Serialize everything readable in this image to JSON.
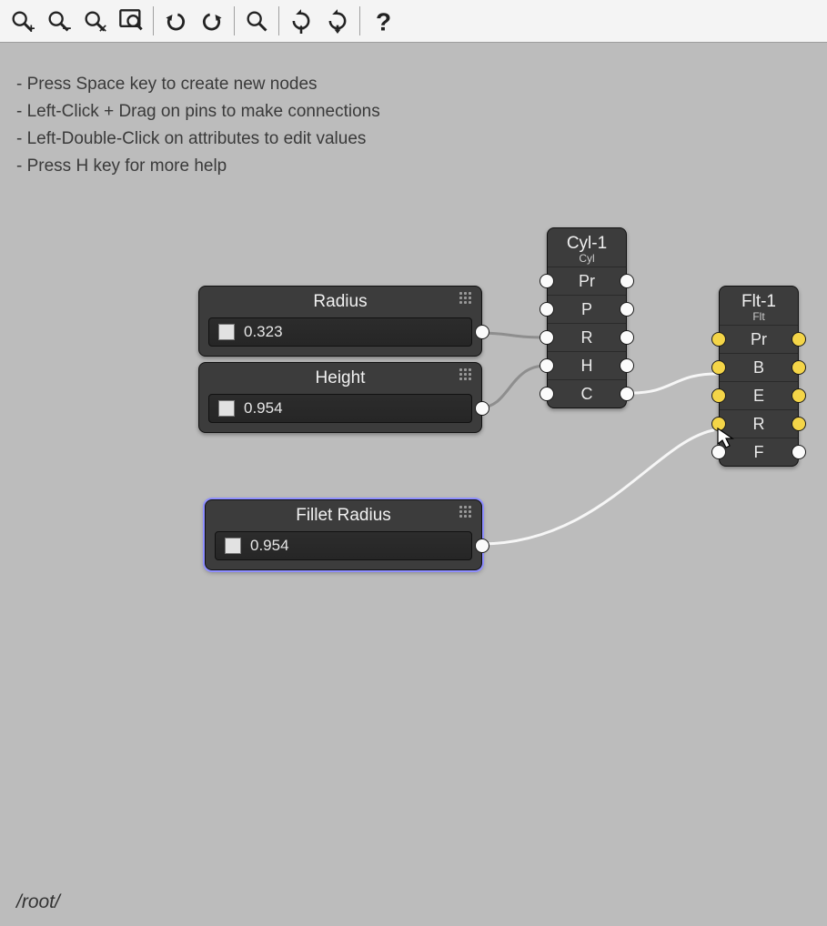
{
  "help_lines": [
    "- Press Space key to create new nodes",
    "- Left-Click + Drag on pins to make connections",
    "- Left-Double-Click on attributes to edit values",
    "- Press H key for more help"
  ],
  "nodes": {
    "radius": {
      "title": "Radius",
      "value": "0.323"
    },
    "height": {
      "title": "Height",
      "value": "0.954"
    },
    "fillet_radius": {
      "title": "Fillet Radius",
      "value": "0.954"
    }
  },
  "cnodes": {
    "cyl": {
      "title": "Cyl-1",
      "sub": "Cyl",
      "rows": [
        {
          "label": "Pr"
        },
        {
          "label": "P"
        },
        {
          "label": "R"
        },
        {
          "label": "H"
        },
        {
          "label": "C"
        }
      ]
    },
    "flt": {
      "title": "Flt-1",
      "sub": "Flt",
      "rows": [
        {
          "label": "Pr"
        },
        {
          "label": "B"
        },
        {
          "label": "E"
        },
        {
          "label": "R"
        },
        {
          "label": "F"
        }
      ]
    }
  },
  "path": "/root/"
}
